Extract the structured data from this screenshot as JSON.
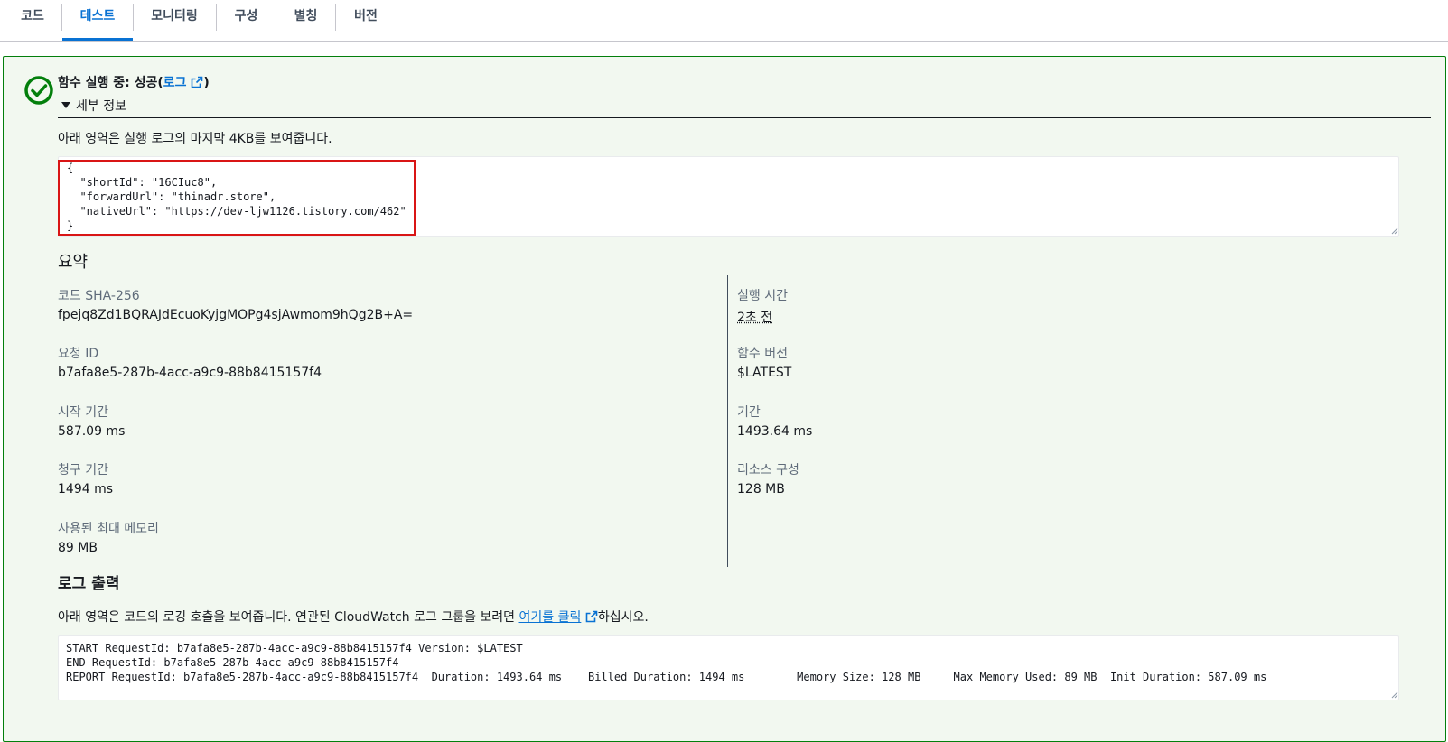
{
  "tabs": [
    {
      "label": "코드",
      "active": false
    },
    {
      "label": "테스트",
      "active": true
    },
    {
      "label": "모니터링",
      "active": false
    },
    {
      "label": "구성",
      "active": false
    },
    {
      "label": "별칭",
      "active": false
    },
    {
      "label": "버전",
      "active": false
    }
  ],
  "status": {
    "prefix": "함수 실행 중: 성공(",
    "log_link": "로그",
    "suffix": ")",
    "color": "#037f0c"
  },
  "details": {
    "toggle_label": "세부 정보",
    "description": "아래 영역은 실행 로그의 마지막 4KB를 보여줍니다.",
    "result": "{\n  \"shortId\": \"16CIuc8\",\n  \"forwardUrl\": \"thinadr.store\",\n  \"nativeUrl\": \"https://dev-ljw1126.tistory.com/462\"\n}"
  },
  "summary": {
    "title": "요약",
    "left": [
      {
        "label": "코드 SHA-256",
        "value": "fpejq8Zd1BQRAJdEcuoKyjgMOPg4sjAwmom9hQg2B+A="
      },
      {
        "label": "요청 ID",
        "value": "b7afa8e5-287b-4acc-a9c9-88b8415157f4"
      },
      {
        "label": "시작 기간",
        "value": "587.09 ms"
      },
      {
        "label": "청구 기간",
        "value": "1494 ms"
      },
      {
        "label": "사용된 최대 메모리",
        "value": "89 MB"
      }
    ],
    "right": [
      {
        "label": "실행 시간",
        "value": "2초 전"
      },
      {
        "label": "함수 버전",
        "value": "$LATEST"
      },
      {
        "label": "기간",
        "value": "1493.64 ms"
      },
      {
        "label": "리소스 구성",
        "value": "128 MB"
      }
    ]
  },
  "log_output": {
    "title": "로그 출력",
    "desc_prefix": "아래 영역은 코드의 로깅 호출을 보여줍니다. 연관된 CloudWatch 로그 그룹을 보려면 ",
    "desc_link": "여기를 클릭",
    "desc_suffix": "하십시오.",
    "text": "START RequestId: b7afa8e5-287b-4acc-a9c9-88b8415157f4 Version: $LATEST\nEND RequestId: b7afa8e5-287b-4acc-a9c9-88b8415157f4\nREPORT RequestId: b7afa8e5-287b-4acc-a9c9-88b8415157f4  Duration: 1493.64 ms    Billed Duration: 1494 ms        Memory Size: 128 MB     Max Memory Used: 89 MB  Init Duration: 587.09 ms"
  },
  "icons": {
    "status": "success-check-circle-icon",
    "toggle": "caret-down-icon",
    "external": "external-link-icon"
  },
  "colors": {
    "accent": "#0972d3",
    "success": "#037f0c",
    "success_bg": "#f2f8f0",
    "highlight": "#d91515"
  }
}
